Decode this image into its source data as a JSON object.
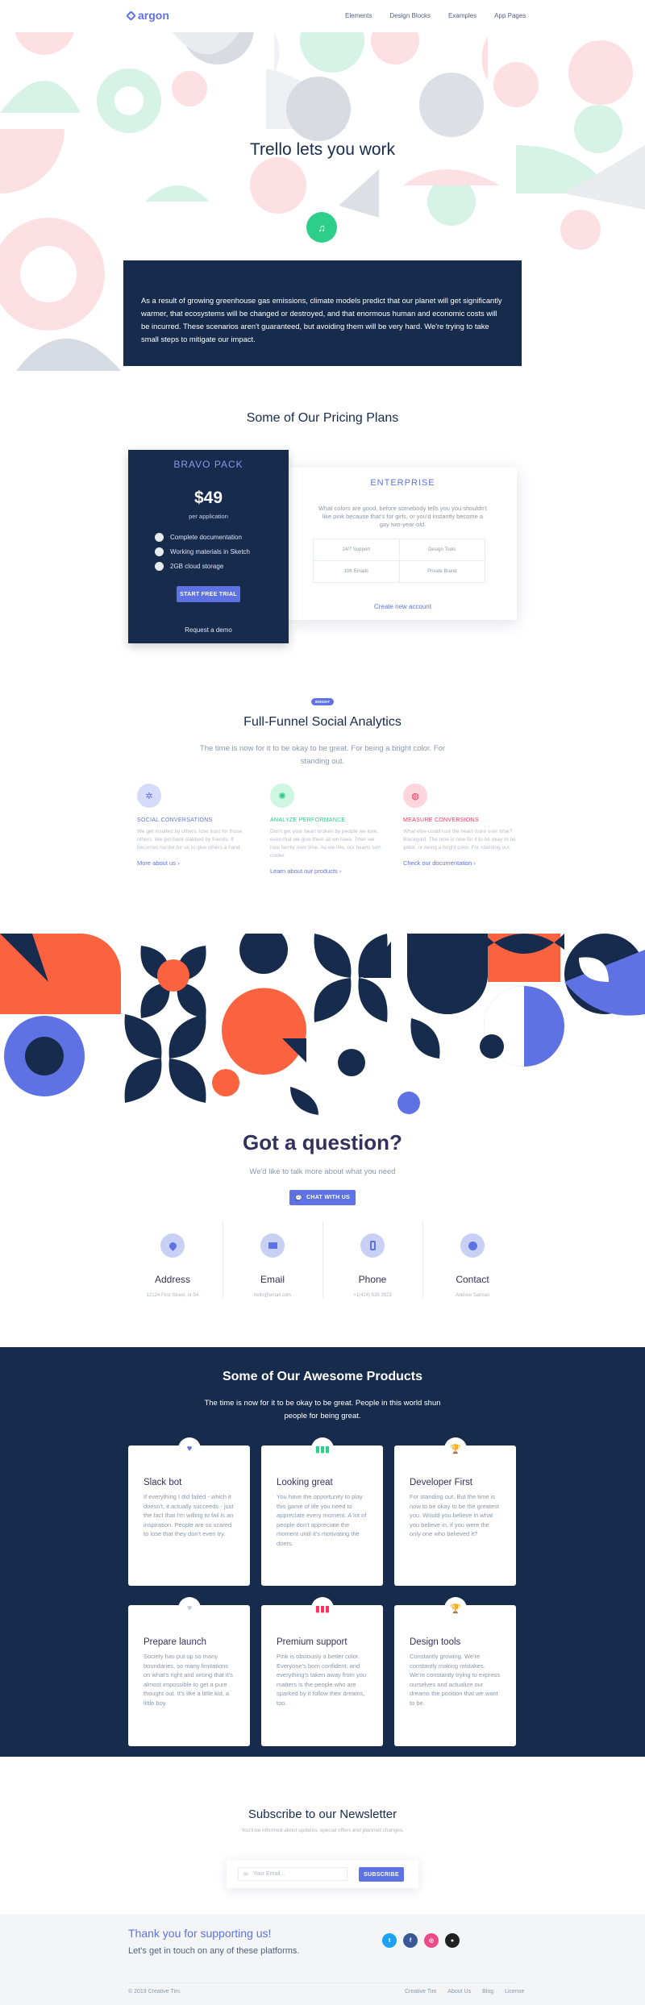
{
  "nav": {
    "brand": "argon",
    "links": [
      "Elements",
      "Design Blocks",
      "Examples",
      "App Pages"
    ]
  },
  "hero": {
    "title": "Trello lets you work",
    "text": "As a result of growing greenhouse gas emissions, climate models predict that our planet will get significantly warmer, that ecosystems will be changed or destroyed, and that enormous human and economic costs will be incurred. These scenarios aren't guaranteed, but avoiding them will be very hard. We're trying to take small steps to mitigate our impact."
  },
  "pricing": {
    "title": "Some of Our Pricing Plans",
    "bravo": {
      "name": "BRAVO PACK",
      "price": "$49",
      "period": "per application",
      "features": [
        "Complete documentation",
        "Working materials in Sketch",
        "2GB cloud storage"
      ],
      "button": "START FREE TRIAL",
      "link": "Request a demo"
    },
    "enterprise": {
      "name": "ENTERPRISE",
      "text": "What colors are good, before somebody tells you you shouldn't like pink because that's for girls, or you'd instantly become a gay two-year-old.",
      "table": [
        [
          "24/7 Support",
          "Design Tools"
        ],
        [
          "10K Emails",
          "Private Brand"
        ]
      ],
      "link": "Create new account"
    }
  },
  "analytics": {
    "badge": "INSIGHT",
    "title": "Full-Funnel Social Analytics",
    "subtitle": "The time is now for it to be okay to be great. For being a bright color. For standing out.",
    "columns": [
      {
        "heading": "SOCIAL CONVERSATIONS",
        "text": "We get insulted by others, lose trust for those others. We get back stabbed by friends. It becomes harder for us to give others a hand.",
        "link": "More about us",
        "color": "#5e72e4",
        "bg": "#d6dbfa"
      },
      {
        "heading": "ANALYZE PERFORMANCE",
        "text": "Don't get your heart broken by people we love, even that we give them all we have. Then we lose family over time. As we live, our hearts turn colder.",
        "link": "Learn about our products",
        "color": "#2dce89",
        "bg": "#cff5e3"
      },
      {
        "heading": "MEASURE CONVERSIONS",
        "text": "What else could rust the heart more over time? Blackgold. The time is now for it to be okay to be great. or being a bright color. For standing out.",
        "link": "Check our documentation",
        "color": "#f5365c",
        "bg": "#fdd5dd"
      }
    ]
  },
  "question": {
    "title": "Got a question?",
    "subtitle": "We'd like to talk more about what you need",
    "button": "CHAT WITH US",
    "contacts": [
      {
        "label": "Address",
        "value": "12124 First Street, nr 54"
      },
      {
        "label": "Email",
        "value": "hello@email.com"
      },
      {
        "label": "Phone",
        "value": "+1(424) 535 3523"
      },
      {
        "label": "Contact",
        "value": "Andrew Samian"
      }
    ]
  },
  "products": {
    "title": "Some of Our Awesome Products",
    "subtitle": "The time is now for it to be okay to be great. People in this world shun people for being great.",
    "cards": [
      {
        "title": "Slack bot",
        "text": "If everything I did failed - which it doesn't, it actually succeeds - just the fact that I'm willing to fail is an inspiration. People are so scared to lose that they don't even try.",
        "icon": "heart-icon",
        "color": "#5e72e4"
      },
      {
        "title": "Looking great",
        "text": "You have the opportunity to play this game of life you need to appreciate every moment. A lot of people don't appreciate the moment until it's motivating the doers.",
        "icon": "bars-icon",
        "color": "#2dce89"
      },
      {
        "title": "Developer First",
        "text": "For standing out. But the time is now to be okay to be the greatest you. Would you believe in what you believe in, if you were the only one who believed it?",
        "icon": "trophy-icon",
        "color": "#f5365c"
      },
      {
        "title": "Prepare launch",
        "text": "Society has put up so many boundaries, so many limitations on what's right and wrong that it's almost impossible to get a pure thought out. It's like a little kid, a little boy.",
        "icon": "heart-icon",
        "color": "#adb5bd"
      },
      {
        "title": "Premium support",
        "text": "Pink is obviously a better color. Everyone's born confident, and everything's taken away from you matters is the people who are sparked by it follow their dreams, too.",
        "icon": "bars-icon",
        "color": "#f5365c"
      },
      {
        "title": "Design tools",
        "text": "Constantly growing. We're constantly making mistakes. We're constantly trying to express ourselves and actualize our dreams the position that we want to be.",
        "icon": "trophy-icon",
        "color": "#11cdef"
      }
    ]
  },
  "newsletter": {
    "title": "Subscribe to our Newsletter",
    "subtitle": "You'll be informed about updates, special offers and planned changes.",
    "placeholder": "Your Email...",
    "button": "SUBSCRIBE"
  },
  "footer": {
    "thanks": "Thank you for supporting us!",
    "touch": "Let's get in touch on any of these platforms.",
    "copyright": "© 2019 Creative Tim.",
    "links": [
      "Creative Tim",
      "About Us",
      "Blog",
      "License"
    ],
    "social": [
      {
        "name": "twitter-icon",
        "glyph": "t",
        "color": "#1da1f2"
      },
      {
        "name": "facebook-icon",
        "glyph": "f",
        "color": "#3b5999"
      },
      {
        "name": "dribbble-icon",
        "glyph": "◎",
        "color": "#ea4c89"
      },
      {
        "name": "github-icon",
        "glyph": "●",
        "color": "#222222"
      }
    ]
  }
}
